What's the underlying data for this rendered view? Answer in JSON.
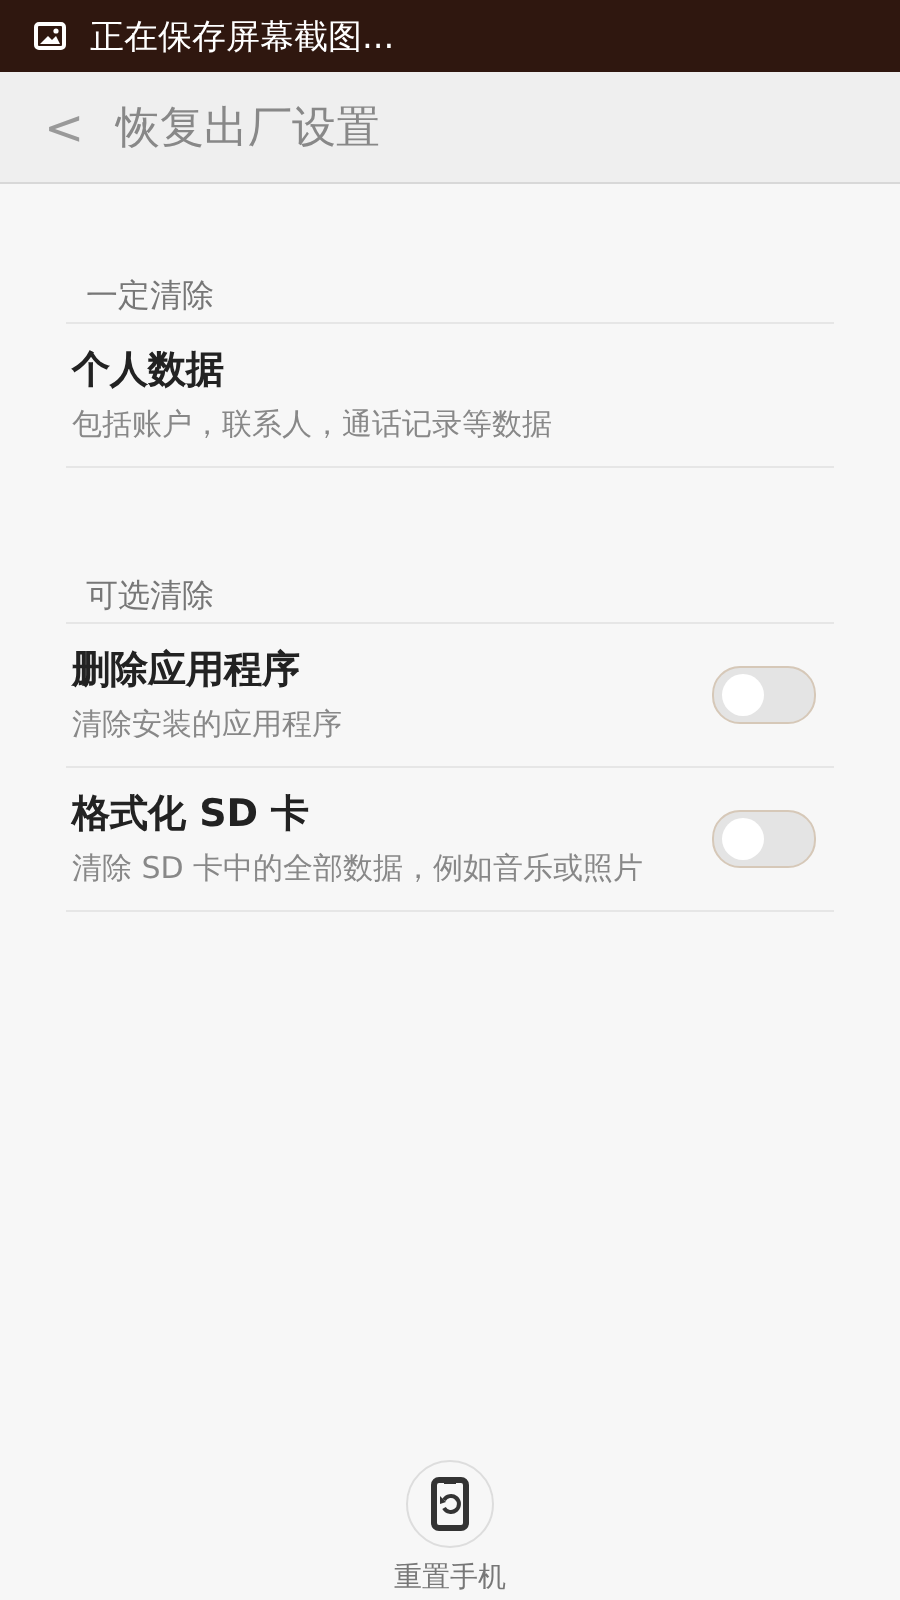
{
  "status_bar": {
    "notification": "正在保存屏幕截图..."
  },
  "header": {
    "back": "<",
    "title": "恢复出厂设置"
  },
  "sections": [
    {
      "title": "一定清除",
      "items": [
        {
          "kind": "info",
          "title": "个人数据",
          "subtitle": "包括账户，联系人，通话记录等数据"
        }
      ]
    },
    {
      "title": "可选清除",
      "items": [
        {
          "kind": "toggle",
          "title": "删除应用程序",
          "subtitle": "清除安装的应用程序",
          "on": false
        },
        {
          "kind": "toggle",
          "title": "格式化 SD 卡",
          "subtitle": "清除 SD 卡中的全部数据，例如音乐或照片",
          "on": false
        }
      ]
    }
  ],
  "reset_button": {
    "label": "重置手机"
  }
}
